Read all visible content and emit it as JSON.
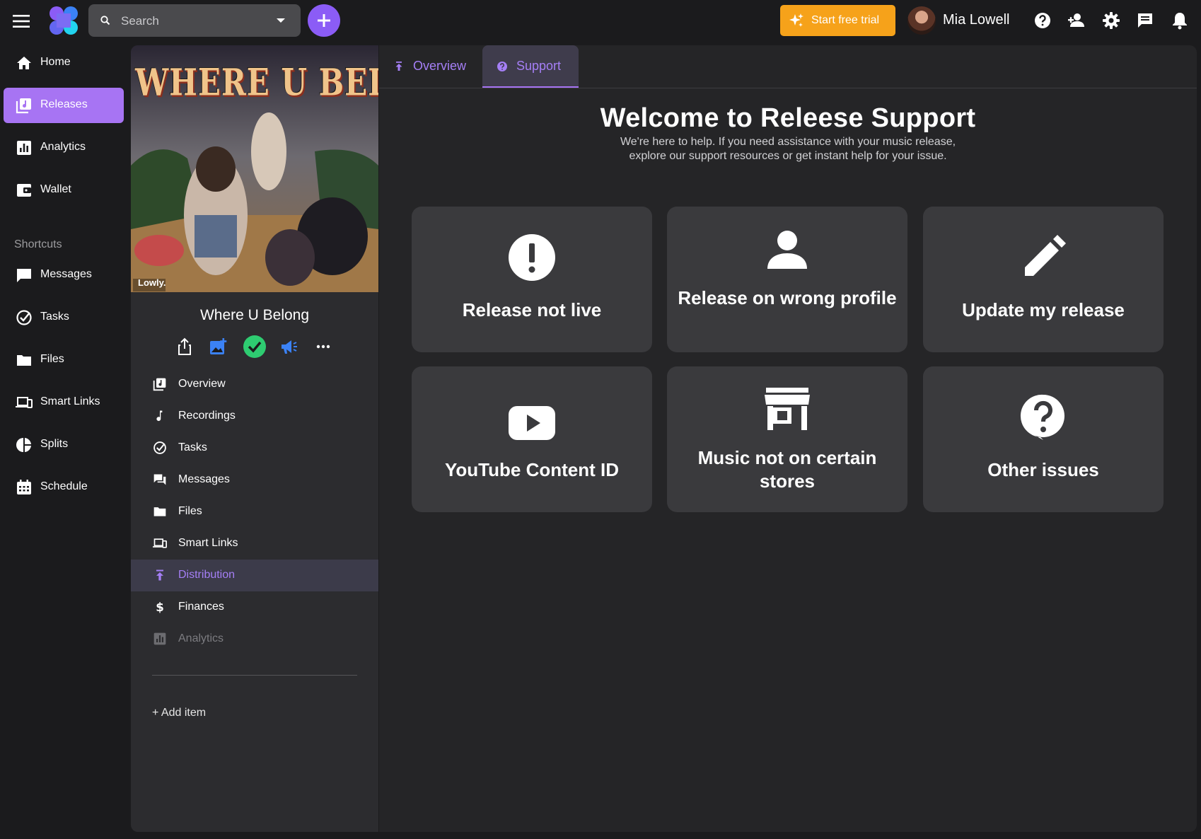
{
  "colors": {
    "accent": "#a774f3",
    "trial": "#f6a21a",
    "background": "#1b1b1d",
    "card": "#3a3a3d"
  },
  "topbar": {
    "search_placeholder": "Search",
    "trial_label": "Start free trial",
    "user_name": "Mia Lowell",
    "icons": [
      "help-icon",
      "add-user-icon",
      "settings-icon",
      "chat-icon",
      "bell-icon"
    ]
  },
  "leftnav": {
    "items": [
      {
        "label": "Home",
        "icon": "home-icon"
      },
      {
        "label": "Releases",
        "icon": "releases-icon",
        "active": true
      },
      {
        "label": "Analytics",
        "icon": "analytics-icon"
      },
      {
        "label": "Wallet",
        "icon": "wallet-icon"
      }
    ],
    "shortcuts_title": "Shortcuts",
    "shortcuts": [
      {
        "label": "Messages",
        "icon": "message-icon"
      },
      {
        "label": "Tasks",
        "icon": "task-check-icon"
      },
      {
        "label": "Files",
        "icon": "folder-icon"
      },
      {
        "label": "Smart Links",
        "icon": "devices-icon"
      },
      {
        "label": "Splits",
        "icon": "pie-icon"
      },
      {
        "label": "Schedule",
        "icon": "calendar-icon"
      }
    ]
  },
  "release": {
    "cover_text": "WHERE U BELONG",
    "cover_label": "Lowly.",
    "title": "Where U Belong",
    "menu": [
      {
        "label": "Overview",
        "icon": "releases-icon"
      },
      {
        "label": "Recordings",
        "icon": "music-note-icon"
      },
      {
        "label": "Tasks",
        "icon": "task-check-icon"
      },
      {
        "label": "Messages",
        "icon": "chat-icon"
      },
      {
        "label": "Files",
        "icon": "folder-icon"
      },
      {
        "label": "Smart Links",
        "icon": "devices-icon"
      },
      {
        "label": "Distribution",
        "icon": "upload-icon",
        "active": true
      },
      {
        "label": "Finances",
        "icon": "dollar-icon"
      },
      {
        "label": "Analytics",
        "icon": "analytics-icon",
        "disabled": true
      }
    ],
    "add_item_label": "+ Add item"
  },
  "main": {
    "tabs": [
      {
        "label": "Overview",
        "icon": "upload-icon"
      },
      {
        "label": "Support",
        "icon": "help-icon",
        "active": true
      }
    ],
    "welcome_title": "Welcome to Releese Support",
    "welcome_sub": "We're here to help. If you need assistance with your music release, explore our support resources or get instant help for your issue.",
    "cards": [
      {
        "label": "Release not live",
        "icon": "alert-icon"
      },
      {
        "label": "Release on wrong profile",
        "icon": "person-icon"
      },
      {
        "label": "Update my release",
        "icon": "pencil-icon"
      },
      {
        "label": "YouTube Content ID",
        "icon": "youtube-icon"
      },
      {
        "label": "Music not on certain stores",
        "icon": "store-icon"
      },
      {
        "label": "Other issues",
        "icon": "question-icon"
      }
    ]
  }
}
